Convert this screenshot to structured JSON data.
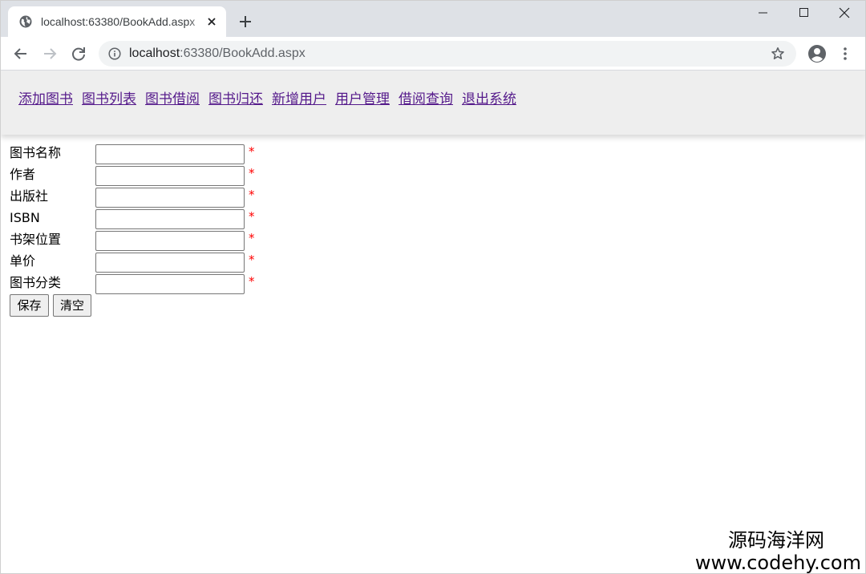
{
  "browser": {
    "tab_title": "localhost:63380/BookAdd.aspx",
    "url_host": "localhost",
    "url_rest": ":63380/BookAdd.aspx"
  },
  "nav": {
    "links": [
      "添加图书",
      "图书列表",
      "图书借阅",
      "图书归还",
      "新增用户",
      "用户管理",
      "借阅查询",
      "退出系统"
    ]
  },
  "form": {
    "fields": [
      {
        "label": "图书名称",
        "value": "",
        "required_mark": "*"
      },
      {
        "label": "作者",
        "value": "",
        "required_mark": "*"
      },
      {
        "label": "出版社",
        "value": "",
        "required_mark": "*"
      },
      {
        "label": "ISBN",
        "value": "",
        "required_mark": "*"
      },
      {
        "label": "书架位置",
        "value": "",
        "required_mark": "*"
      },
      {
        "label": "单价",
        "value": "",
        "required_mark": "*"
      },
      {
        "label": "图书分类",
        "value": "",
        "required_mark": "*"
      }
    ],
    "save_label": "保存",
    "clear_label": "清空"
  },
  "watermark": {
    "line1": "源码海洋网",
    "line2": "www.codehy.com"
  },
  "colors": {
    "link": "#551a8b",
    "required": "#ff0000",
    "nav_background": "#eeeeee",
    "tabstrip": "#dee1e6"
  }
}
